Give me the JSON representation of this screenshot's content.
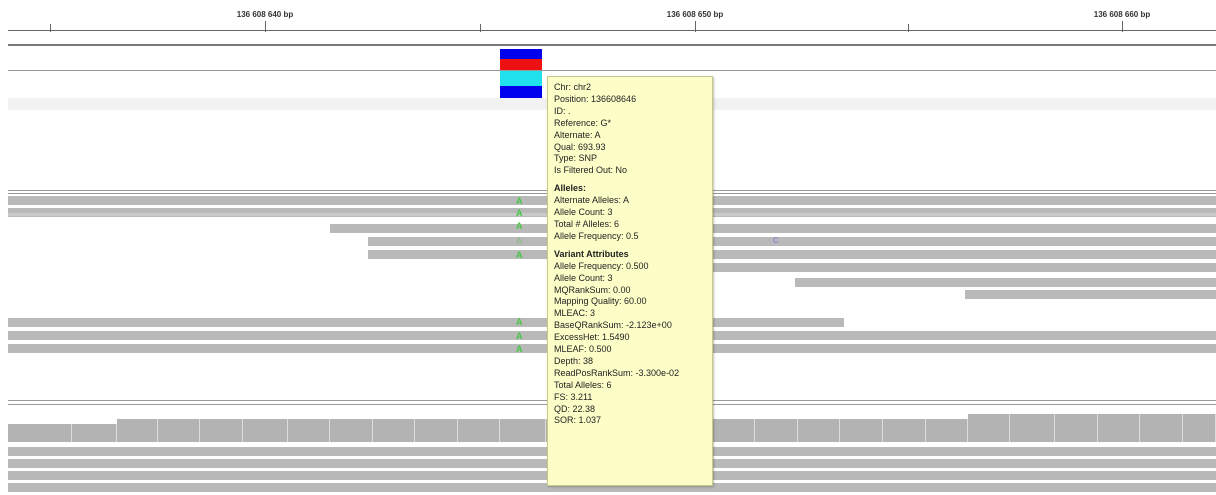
{
  "ruler": {
    "labels": [
      "136 608 640 bp",
      "136 608 650 bp",
      "136 608 660 bp"
    ]
  },
  "colors": {
    "variant_top": "#0000ee",
    "variant_red": "#ee1111",
    "variant_cyan": "#22e1ef",
    "read_fill": "#b9b9b9",
    "allele_a": "#43c643",
    "mismatch_c": "#7a7ae0",
    "tooltip_bg": "#fdfdc8"
  },
  "read_alleles": [
    "A",
    "A",
    "A",
    "A",
    "A",
    "A",
    "A",
    "A"
  ],
  "mismatch_base": "C",
  "tooltip": {
    "basic": [
      "Chr: chr2",
      "Position: 136608646",
      "ID: .",
      "Reference: G*",
      "Alternate: A",
      "Qual: 693.93",
      "Type: SNP",
      "Is Filtered Out: No"
    ],
    "alleles_header": "Alleles:",
    "alleles": [
      "Alternate Alleles: A",
      "Allele Count: 3",
      "Total # Alleles: 6",
      "Allele Frequency: 0.5"
    ],
    "attributes_header": "Variant Attributes",
    "attributes": [
      "Allele Frequency: 0.500",
      "Allele Count: 3",
      "MQRankSum: 0.00",
      "Mapping Quality: 60.00",
      "MLEAC: 3",
      "BaseQRankSum: -2.123e+00",
      "ExcessHet: 1.5490",
      "MLEAF: 0.500",
      "Depth: 38",
      "ReadPosRankSum: -3.300e-02",
      "Total Alleles: 6",
      "FS: 3.211",
      "QD: 22.38",
      "SOR: 1.037"
    ]
  }
}
